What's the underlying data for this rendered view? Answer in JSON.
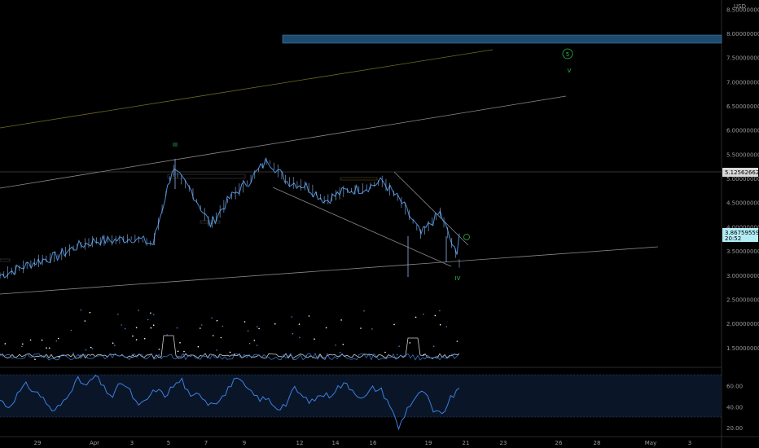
{
  "chart_data": [
    {
      "type": "line",
      "title": "",
      "price_axis": {
        "currency_label": "USD",
        "ticks": [
          "8.50000000",
          "8.00000000",
          "7.50000000",
          "7.00000000",
          "6.50000000",
          "6.00000000",
          "5.50000000",
          "5.00000000",
          "4.50000000",
          "4.00000000",
          "3.50000000",
          "3.00000000",
          "2.50000000",
          "2.00000000",
          "1.50000000"
        ],
        "ylim": [
          1.1,
          8.7
        ],
        "scale": "linear"
      },
      "time_axis": {
        "labels": [
          "29",
          "Apr",
          "3",
          "5",
          "7",
          "9",
          "12",
          "14",
          "16",
          "19",
          "21",
          "23",
          "26",
          "28",
          "May",
          "3"
        ]
      },
      "series": [
        {
          "x": [
            "Mar 27",
            "Mar 28",
            "Mar 29",
            "Mar 30",
            "Mar 31",
            "Apr 1",
            "Apr 2",
            "Apr 3",
            "Apr 4",
            "Apr 5",
            "Apr 6",
            "Apr 7",
            "Apr 8",
            "Apr 9",
            "Apr 10",
            "Apr 11",
            "Apr 12",
            "Apr 13",
            "Apr 14",
            "Apr 15",
            "Apr 16",
            "Apr 17",
            "Apr 18",
            "Apr 19",
            "Apr 20"
          ],
          "values": [
            3.0,
            3.15,
            3.3,
            3.4,
            3.6,
            3.72,
            3.73,
            3.78,
            3.65,
            5.2,
            4.75,
            4.05,
            4.6,
            4.95,
            5.4,
            4.95,
            4.85,
            4.55,
            4.75,
            4.8,
            4.95,
            4.5,
            3.85,
            4.3,
            3.25
          ],
          "last_value": 3.86759559
        }
      ],
      "price_tags": [
        {
          "value": "5.12562662",
          "color": "#d9d9d9"
        },
        {
          "value": "3.86759559",
          "sub": "20:52",
          "color": "#b3ecf5"
        }
      ],
      "annotations": [
        "III",
        "IV",
        "5",
        "V"
      ],
      "colors": {
        "background": "#000000",
        "price_line": "#4a8fd8",
        "zone": "#1e4a6b",
        "wave_labels": "#2dbb4e"
      }
    },
    {
      "type": "line",
      "title": "",
      "ticks": [
        "60.00",
        "40.00",
        "20.00"
      ],
      "ylim": [
        12,
        77
      ],
      "series": [
        {
          "values": [
            47,
            40,
            52,
            61,
            55,
            49,
            35,
            42,
            55,
            66,
            60,
            70,
            58,
            50,
            64,
            55,
            40,
            48,
            57,
            51,
            60,
            66,
            48,
            54,
            44,
            46,
            52,
            67,
            62,
            53,
            48,
            47,
            39,
            43,
            58,
            49,
            45,
            52,
            51,
            59,
            62,
            54,
            48,
            58,
            56,
            42,
            20,
            39,
            50,
            55,
            35,
            33,
            48,
            58
          ]
        }
      ],
      "colors": {
        "line": "#3d7fe0",
        "band": "#0a1628"
      }
    }
  ]
}
